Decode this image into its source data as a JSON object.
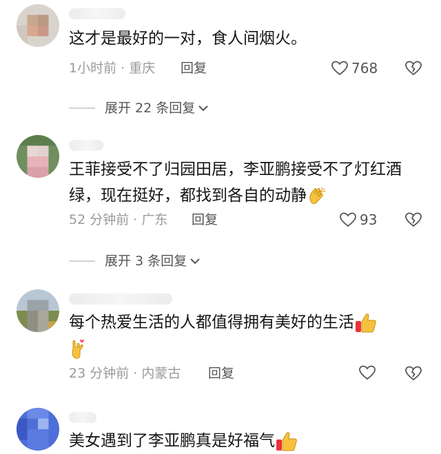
{
  "comments": [
    {
      "text": "这才是最好的一对，食人间烟火。",
      "meta": "1小时前 · 重庆",
      "reply_label": "回复",
      "likes": "768",
      "expand_label": "展开 22 条回复"
    },
    {
      "text": "王菲接受不了归园田居，李亚鹏接受不了灯红酒绿，现在挺好，都找到各自的动静",
      "meta": "52 分钟前 · 广东",
      "reply_label": "回复",
      "likes": "93",
      "expand_label": "展开 3 条回复",
      "emoji": "clapping-hands-icon"
    },
    {
      "text": "每个热爱生活的人都值得拥有美好的生活",
      "meta": "23 分钟前 · 内蒙古",
      "reply_label": "回复",
      "likes": "",
      "emojis": [
        "thumbs-up-icon",
        "love-you-hand-icon"
      ]
    },
    {
      "text": "美女遇到了李亚鹏真是好福气",
      "emoji": "thumbs-up-icon"
    }
  ],
  "colors": {
    "text": "#161616",
    "meta": "#9a9a9a",
    "action": "#555555",
    "emoji_yellow": "#f6c23e"
  }
}
